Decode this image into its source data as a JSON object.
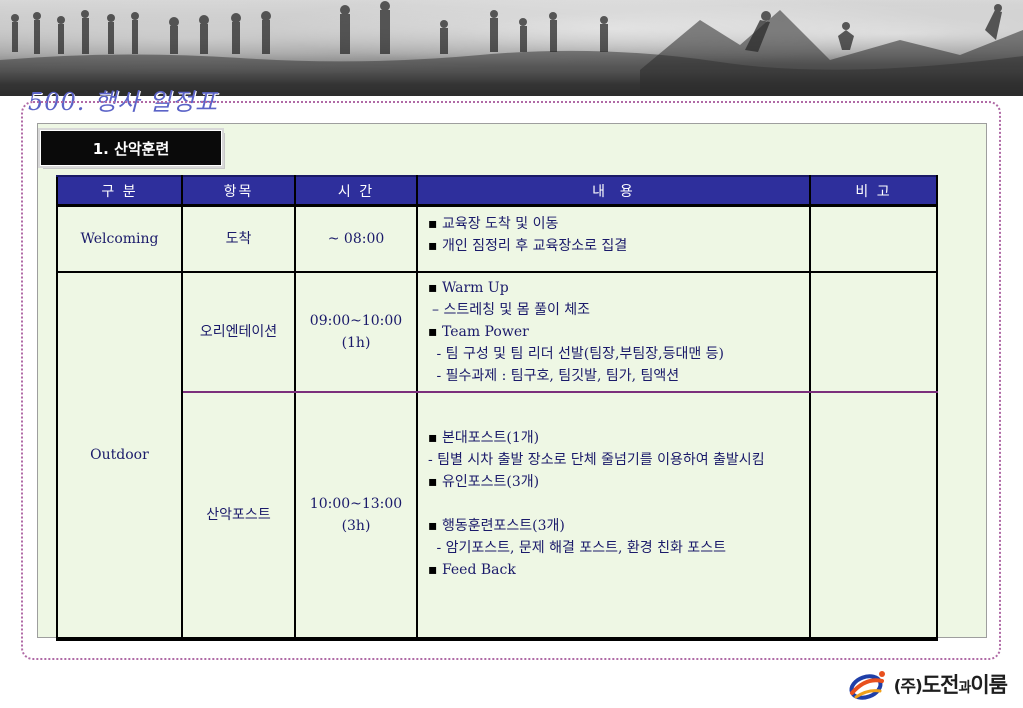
{
  "page_title": "500. 행사 일정표",
  "section_label": "1. 산악훈련",
  "table": {
    "headers": [
      "구 분",
      "항목",
      "시 간",
      "내  용",
      "비 고"
    ],
    "rows": [
      {
        "category": "Welcoming",
        "item": "도착",
        "time": "~ 08:00",
        "content": [
          "교육장 도착 및 이동",
          "개인 짐정리 후 교육장소로 집결"
        ],
        "note": ""
      },
      {
        "category": "Outdoor",
        "item": "오리엔테이션",
        "time_line1": "09:00~10:00",
        "time_line2": "(1h)",
        "content": {
          "b1": "Warm Up",
          "d1": "– 스트레칭 및 몸 풀이 체조",
          "b2": "Team Power",
          "d2": " - 팀 구성 및 팀 리더 선발(팀장,부팀장,등대맨 등)",
          "d3": " - 필수과제 : 팀구호, 팀깃발, 팀가, 팀액션"
        },
        "note": ""
      },
      {
        "item": "산악포스트",
        "time_line1": "10:00~13:00",
        "time_line2": "(3h)",
        "content": {
          "b1": "본대포스트(1개)",
          "d1": " - 팀별 시차 출발 장소로 단체 줄넘기를 이용하여 출발시킴",
          "b2": "유인포스트(3개)",
          "b3": "행동훈련포스트(3개)",
          "d2": " - 암기포스트, 문제 해결 포스트, 환경 친화 포스트",
          "b4": "Feed Back"
        },
        "note": ""
      }
    ]
  },
  "logo": {
    "prefix": "(주)",
    "name1": "도전",
    "connector": "과",
    "name2": "이룸"
  },
  "colors": {
    "header_bg": "#2e2f9c",
    "panel_bg": "#eef7e4",
    "title": "#5b63c7",
    "frame": "#b06aa6"
  }
}
